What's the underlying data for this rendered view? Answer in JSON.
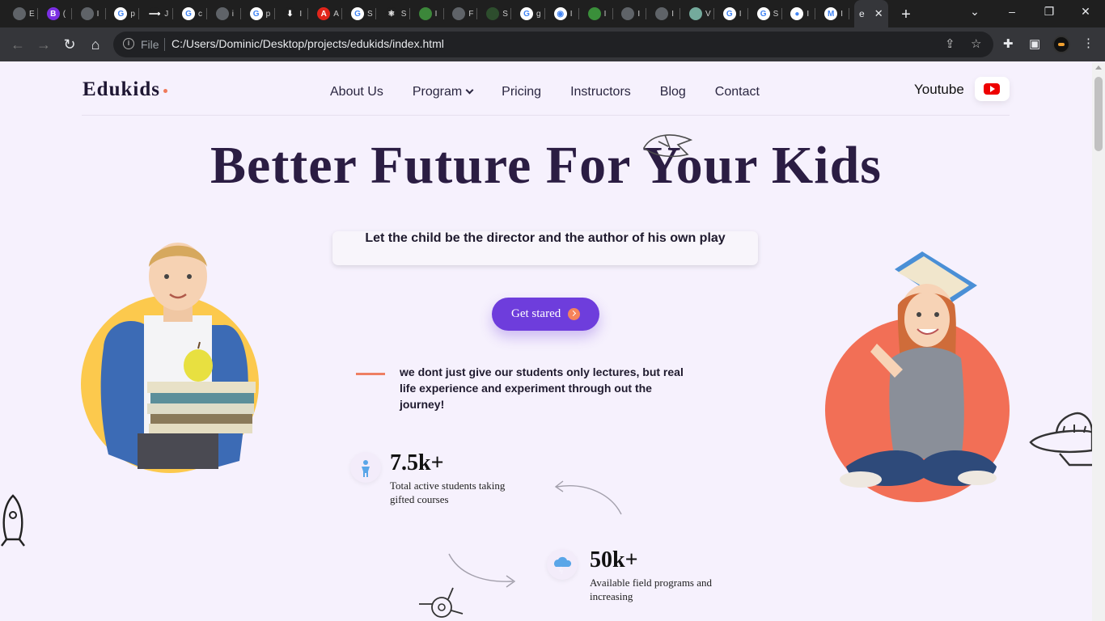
{
  "browser": {
    "tabs": [
      {
        "icon": "globe-icon",
        "text": "E"
      },
      {
        "icon": "bootstrap-icon",
        "text": "("
      },
      {
        "icon": "globe-icon",
        "text": "I"
      },
      {
        "icon": "google-icon",
        "text": "p"
      },
      {
        "icon": "arrow-icon",
        "text": "J"
      },
      {
        "icon": "google-icon",
        "text": "c"
      },
      {
        "icon": "globe-icon",
        "text": "i"
      },
      {
        "icon": "google-icon",
        "text": "p"
      },
      {
        "icon": "download-icon",
        "text": "I"
      },
      {
        "icon": "adobe-icon",
        "text": "A"
      },
      {
        "icon": "google-icon",
        "text": "S"
      },
      {
        "icon": "react-icon",
        "text": "S"
      },
      {
        "icon": "node-icon",
        "text": "I"
      },
      {
        "icon": "store-icon",
        "text": "F"
      },
      {
        "icon": "terminal-icon",
        "text": "S"
      },
      {
        "icon": "google-icon",
        "text": "g"
      },
      {
        "icon": "chrome-icon",
        "text": "I"
      },
      {
        "icon": "chart-icon",
        "text": "I"
      },
      {
        "icon": "globe-icon",
        "text": "I"
      },
      {
        "icon": "globe-icon",
        "text": "I"
      },
      {
        "icon": "openai-icon",
        "text": "V"
      },
      {
        "icon": "google-icon",
        "text": "I"
      },
      {
        "icon": "google-icon",
        "text": "S"
      },
      {
        "icon": "github-icon",
        "text": "I"
      },
      {
        "icon": "gmail-icon",
        "text": "I"
      }
    ],
    "active_tab": "e",
    "address": {
      "scheme_label": "File",
      "url": "C:/Users/Dominic/Desktop/projects/edukids/index.html"
    }
  },
  "site": {
    "logo": "Edukids",
    "nav": [
      "About Us",
      "Program",
      "Pricing",
      "Instructors",
      "Blog",
      "Contact"
    ],
    "youtube_label": "Youtube",
    "hero_title": "Better Future For Your Kids",
    "tagline": "Let the child be the director and the author of his own play",
    "cta_label": "Get stared",
    "quote": "we dont just give our students only lectures, but real life experience and experiment through out the journey!",
    "stats": [
      {
        "icon": "student-icon",
        "value": "7.5k+",
        "label": "Total active students taking gifted courses"
      },
      {
        "icon": "cloud-icon",
        "value": "50k+",
        "label": "Available field programs and increasing"
      }
    ]
  },
  "colors": {
    "accent": "#6e3ddc",
    "heading": "#2b1d43",
    "orange": "#ef7a5a",
    "yellow": "#fcc94d",
    "background": "#f6f1fd"
  }
}
